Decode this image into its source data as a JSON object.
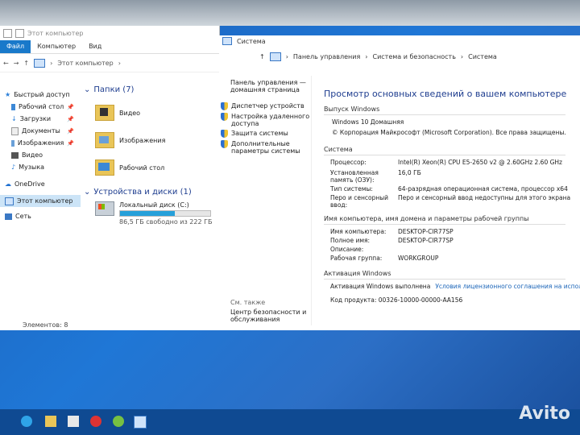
{
  "explorer": {
    "title": "Этот компьютер",
    "ribbon": {
      "file": "Файл",
      "computer": "Компьютер",
      "view": "Вид"
    },
    "address": "Этот компьютер",
    "nav": [
      {
        "label": "Быстрый доступ",
        "icon": "star-icon"
      },
      {
        "label": "Рабочий стол",
        "icon": "desktop-icon",
        "pinned": "📌"
      },
      {
        "label": "Загрузки",
        "icon": "download-icon",
        "pinned": "📌"
      },
      {
        "label": "Документы",
        "icon": "documents-icon",
        "pinned": "📌"
      },
      {
        "label": "Изображения",
        "icon": "images-icon",
        "pinned": "📌"
      },
      {
        "label": "Видео",
        "icon": "video-icon"
      },
      {
        "label": "Музыка",
        "icon": "music-icon"
      },
      {
        "label": "OneDrive",
        "icon": "onedrive-icon"
      },
      {
        "label": "Этот компьютер",
        "icon": "pc-icon"
      },
      {
        "label": "Сеть",
        "icon": "network-icon"
      }
    ],
    "folders_header": "Папки (7)",
    "folders": [
      {
        "label": "Видео"
      },
      {
        "label": "Изображения"
      },
      {
        "label": "Рабочий стол"
      }
    ],
    "devices_header": "Устройства и диски (1)",
    "drive": {
      "label": "Локальный диск (C:)",
      "free": "86,5 ГБ свободно из 222 ГБ",
      "used_fraction": 0.61
    },
    "status": "Элементов: 8"
  },
  "system": {
    "title": "Система",
    "breadcrumb": [
      "Панель управления",
      "Система и безопасность",
      "Система"
    ],
    "left": {
      "home": "Панель управления — домашняя страница",
      "links": [
        "Диспетчер устройств",
        "Настройка удаленного доступа",
        "Защита системы",
        "Дополнительные параметры системы"
      ],
      "see_also": "См. также",
      "security": "Центр безопасности и обслуживания"
    },
    "heading": "Просмотр основных сведений о вашем компьютере",
    "edition_header": "Выпуск Windows",
    "edition": "Windows 10 Домашняя",
    "copyright": "© Корпорация Майкрософт (Microsoft Corporation). Все права защищены.",
    "system_header": "Система",
    "system_rows": [
      {
        "k": "Процессор:",
        "v": "Intel(R) Xeon(R) CPU E5-2650 v2 @ 2.60GHz   2.60 GHz"
      },
      {
        "k": "Установленная память (ОЗУ):",
        "v": "16,0 ГБ"
      },
      {
        "k": "Тип системы:",
        "v": "64-разрядная операционная система, процессор x64"
      },
      {
        "k": "Перо и сенсорный ввод:",
        "v": "Перо и сенсорный ввод недоступны для этого экрана"
      }
    ],
    "name_header": "Имя компьютера, имя домена и параметры рабочей группы",
    "name_rows": [
      {
        "k": "Имя компьютера:",
        "v": "DESKTOP-CIR77SP"
      },
      {
        "k": "Полное имя:",
        "v": "DESKTOP-CIR77SP"
      },
      {
        "k": "Описание:",
        "v": ""
      },
      {
        "k": "Рабочая группа:",
        "v": "WORKGROUP"
      }
    ],
    "activation_header": "Активация Windows",
    "activation": "Активация Windows выполнена",
    "activation_link": "Условия лицензионного соглашения на использование программного обе",
    "product_key": "Код продукта: 00326-10000-00000-AA156"
  },
  "watermark": "Avito"
}
